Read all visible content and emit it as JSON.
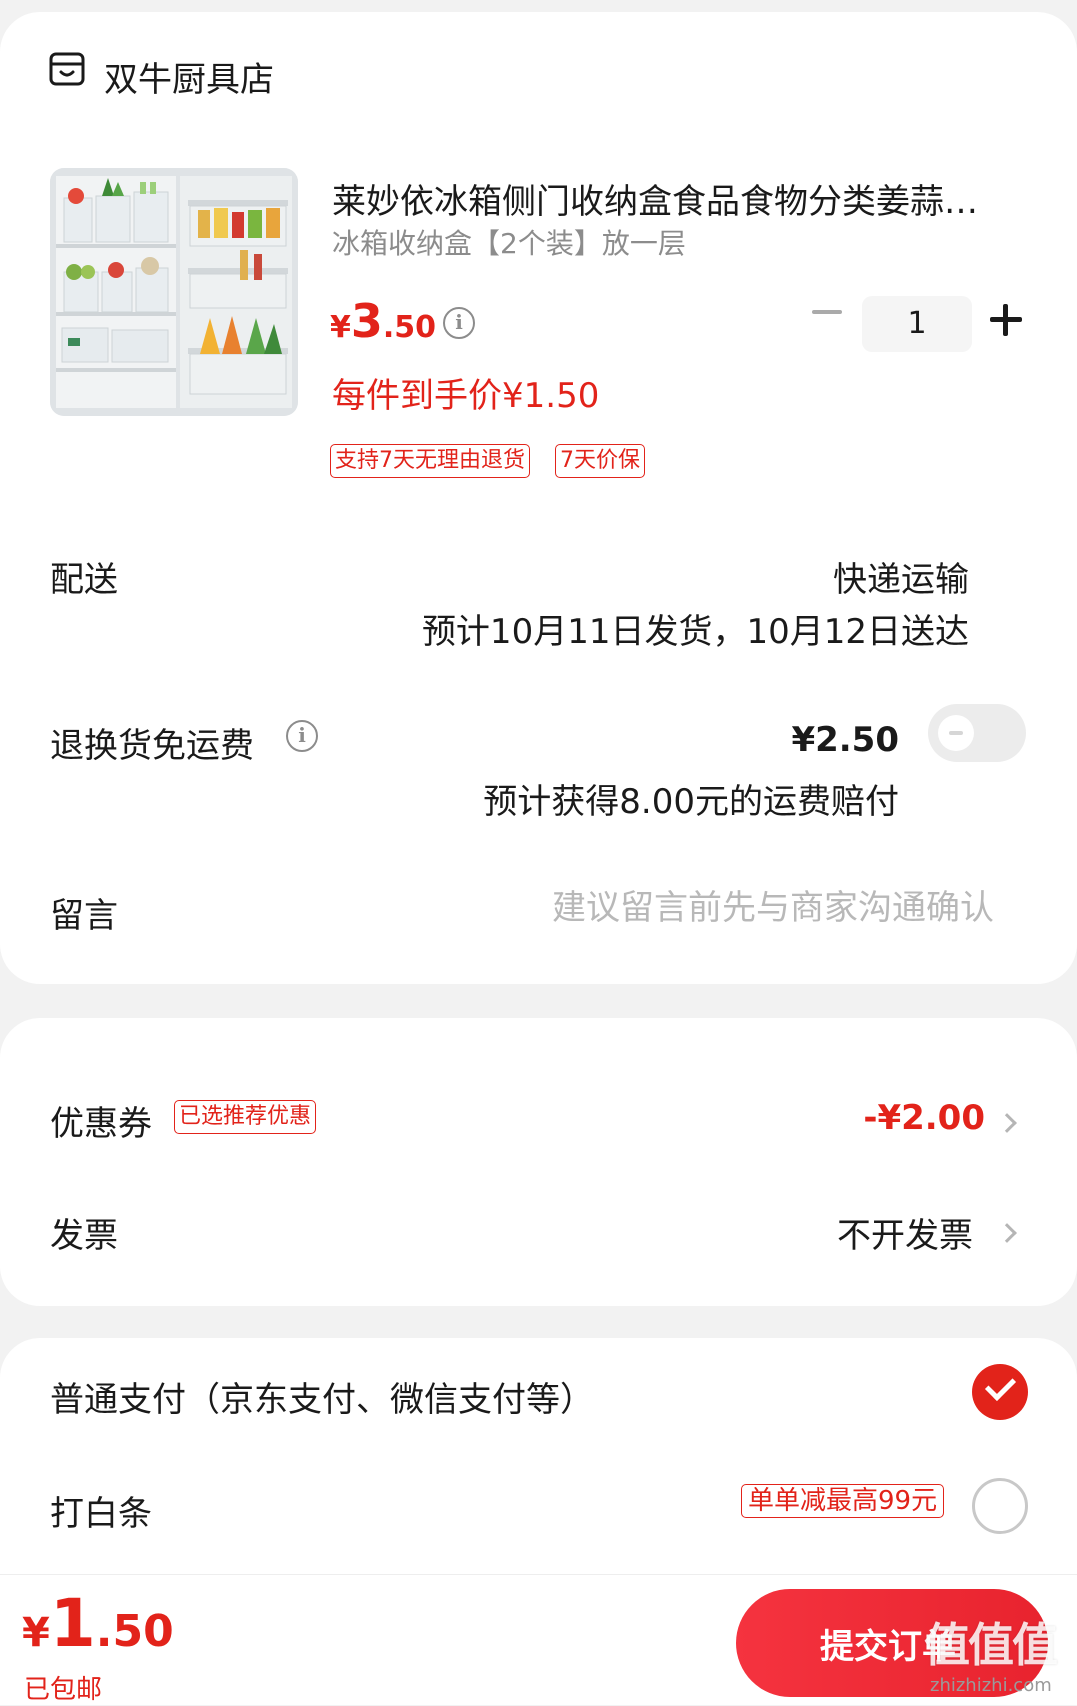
{
  "shop": {
    "name": "双牛厨具店",
    "icon": "shop-icon"
  },
  "product": {
    "title": "莱妙依冰箱侧门收纳盒食品食物分类姜蒜…",
    "spec": "冰箱收纳盒【2个装】放一层",
    "price_currency": "¥",
    "price_integer": "3",
    "price_decimal": ".50",
    "unit_price": "每件到手价¥1.50",
    "tags": [
      "支持7天无理由退货",
      "7天价保"
    ],
    "quantity": "1"
  },
  "delivery": {
    "label": "配送",
    "method": "快递运输",
    "eta": "预计10月11日发货，10月12日送达"
  },
  "return_shipping": {
    "label": "退换货免运费",
    "price": "¥2.50",
    "note": "预计获得8.00元的运费赔付",
    "enabled": false
  },
  "message": {
    "label": "留言",
    "placeholder": "建议留言前先与商家沟通确认"
  },
  "coupon": {
    "label": "优惠券",
    "tag": "已选推荐优惠",
    "value": "-¥2.00"
  },
  "invoice": {
    "label": "发票",
    "value": "不开发票"
  },
  "payment": {
    "options": [
      {
        "label": "普通支付（京东支付、微信支付等）",
        "selected": true
      },
      {
        "label": "打白条",
        "tag": "单单减最高99元",
        "selected": false
      }
    ]
  },
  "footer": {
    "total_currency": "¥",
    "total_integer": "1",
    "total_decimal": ".50",
    "shipping_note": "已包邮",
    "submit_label": "提交订单",
    "watermark": "值值值",
    "watermark_url": "zhizhizhi.com"
  },
  "colors": {
    "accent": "#e2231a",
    "background": "#f2f2f2"
  }
}
